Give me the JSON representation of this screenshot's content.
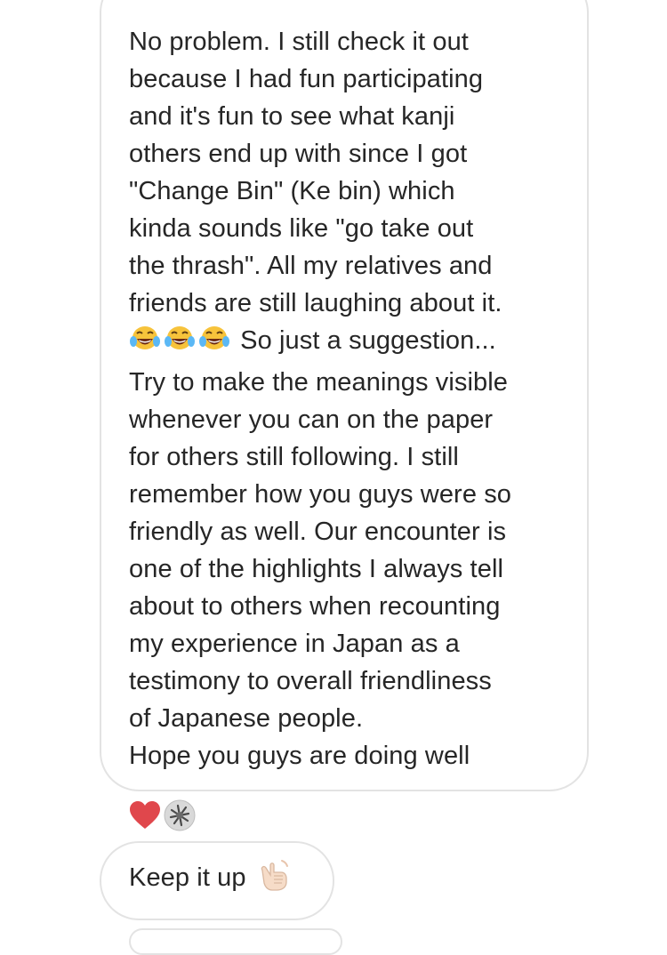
{
  "thread": {
    "messages": [
      {
        "lines": [
          "No problem. I still check it out",
          "because I had fun participating",
          "and it's fun to see what kanji",
          "others end up with since I got",
          "\"Change Bin\" (Ke bin) which",
          "kinda sounds like \"go take out",
          "the thrash\". All my relatives and",
          "friends are still laughing about it.",
          "So just a suggestion...",
          "Try to make the meanings visible",
          "whenever you can on the paper",
          "for others still following. I still",
          "remember how you guys were so",
          "friendly as well. Our encounter is",
          "one of the highlights I always tell",
          "about to others when recounting",
          "my experience in Japan as a",
          "testimony to overall friendliness",
          "of Japanese people.",
          "Hope you guys are doing well"
        ],
        "inline_emoji": [
          "face-with-tears-of-joy",
          "face-with-tears-of-joy",
          "face-with-tears-of-joy"
        ],
        "reactions": [
          "red-heart-icon",
          "reactor-avatar"
        ]
      },
      {
        "text": "Keep it up",
        "emoji": "call-me-hand-light-skin-tone"
      }
    ]
  },
  "colors": {
    "bubble_border": "#e3e3e3",
    "text": "#262626",
    "heart": "#e0474c",
    "background": "#ffffff"
  }
}
